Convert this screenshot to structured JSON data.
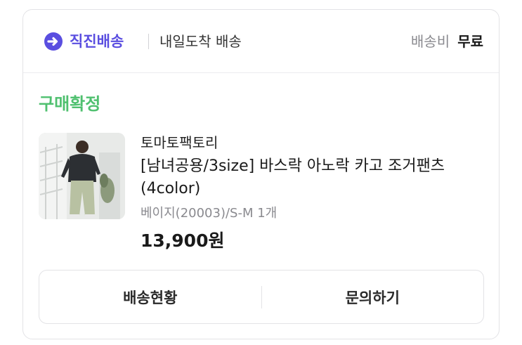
{
  "delivery": {
    "type_label": "직진배송",
    "arrival_label": "내일도착 배송",
    "fee_label": "배송비",
    "fee_value": "무료",
    "icon": "arrow-circle-right-icon"
  },
  "order": {
    "status": "구매확정",
    "store_name": "토마토팩토리",
    "product_name": "[남녀공용/3size] 바스락 아노락 카고 조거팬츠(4color)",
    "option": "베이지(20003)/S-M 1개",
    "price": "13,900원"
  },
  "actions": {
    "track_label": "배송현황",
    "inquiry_label": "문의하기"
  },
  "colors": {
    "brand": "#5a4ee0",
    "status_green": "#4fc06f",
    "border": "#e3e3e6"
  }
}
